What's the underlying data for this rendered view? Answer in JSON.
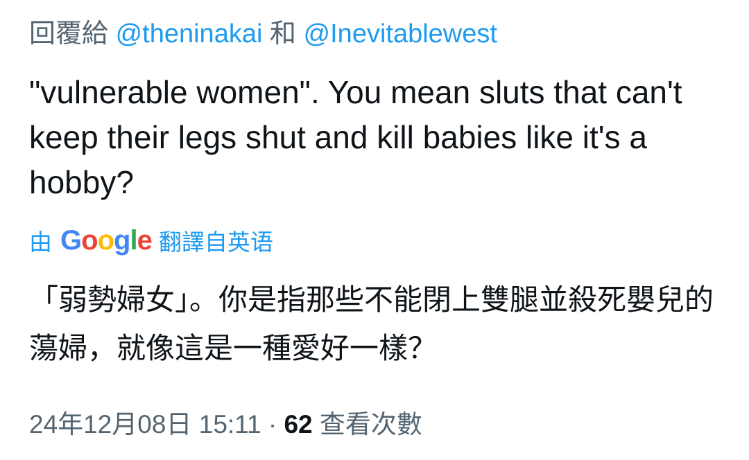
{
  "reply": {
    "prefix": "回覆給",
    "mention_1": "@theninakai",
    "conjunction": "和",
    "mention_2": "@Inevitablewest"
  },
  "tweet": {
    "text": "\"vulnerable women\". You mean sluts that can't keep their legs shut and kill babies like it's a hobby?"
  },
  "translation": {
    "by_label": "由",
    "google_letters": [
      "G",
      "o",
      "o",
      "g",
      "l",
      "e"
    ],
    "source_label": "翻譯自英语",
    "text": "「弱勢婦女」。你是指那些不能閉上雙腿並殺死嬰兒的蕩婦，就像這是一種愛好一樣？"
  },
  "meta": {
    "date_time": "24年12月08日 15:11",
    "separator": "·",
    "views_count": "62",
    "views_label": "查看次數"
  },
  "colors": {
    "link": "#1d9bf0",
    "secondary_text": "#536471",
    "primary_text": "#0f1419",
    "google_blue": "#4285F4",
    "google_red": "#EA4335",
    "google_yellow": "#FBBC05",
    "google_green": "#34A853"
  }
}
